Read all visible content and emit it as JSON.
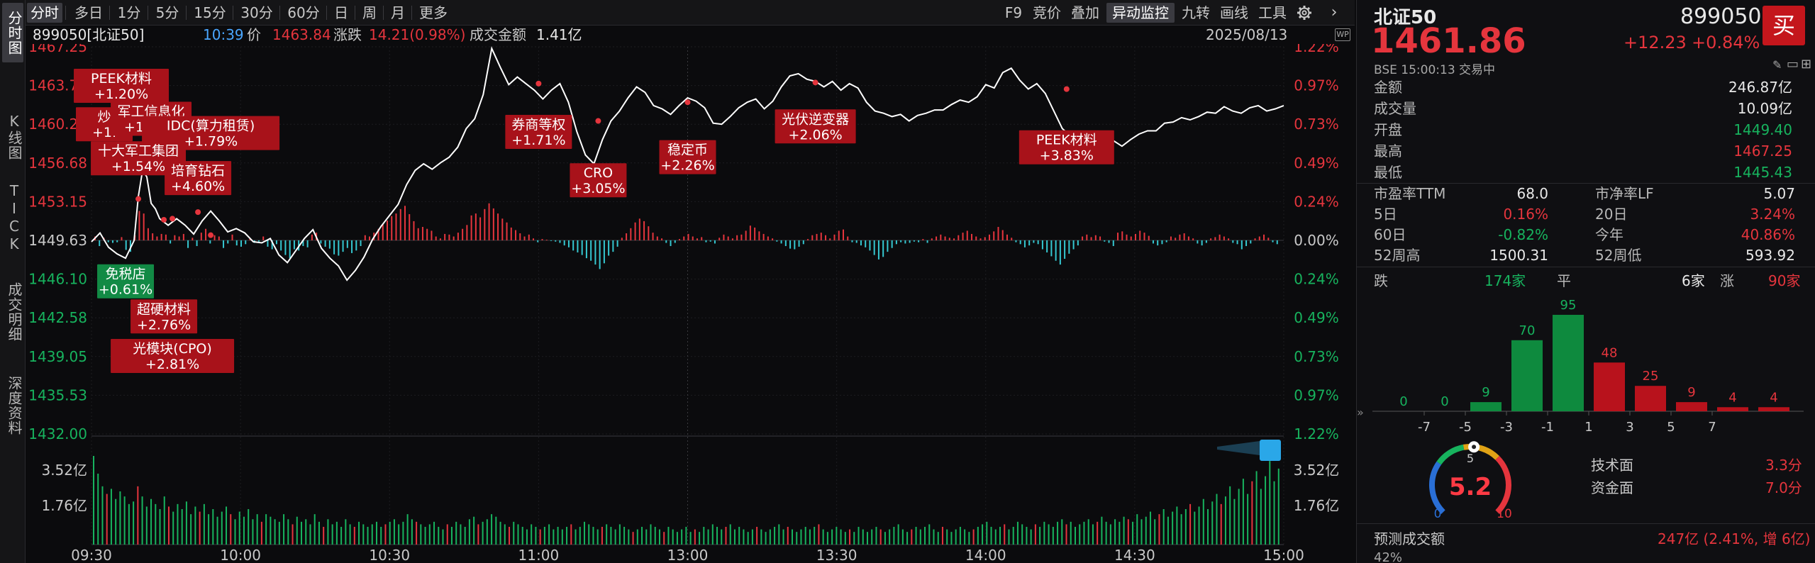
{
  "vtabs": [
    "分时图",
    "K线图",
    "TICK",
    "成交明细",
    "深度资料"
  ],
  "toolbar": {
    "periods": [
      "分时",
      "多日",
      "1分",
      "5分",
      "15分",
      "30分",
      "60分",
      "日",
      "周",
      "月",
      "更多"
    ],
    "tools": [
      "F9",
      "竞价",
      "叠加",
      "异动监控",
      "九转",
      "画线",
      "工具"
    ],
    "settings_icon": "gear-icon",
    "nav_icon": "chevron-right-icon"
  },
  "infoline": {
    "code": "899050[北证50]",
    "time": "10:39",
    "price_label": "价",
    "price": "1463.84",
    "change_label": "涨跌",
    "change": "14.21(0.98%)",
    "amount_label": "成交金额",
    "amount": "1.41亿",
    "date": "2025/08/13",
    "wp_icon": "wp-badge-icon"
  },
  "chart_data": {
    "type": "line",
    "x_ticks": [
      "09:30",
      "10:00",
      "10:30",
      "11:00",
      "13:00",
      "13:30",
      "14:00",
      "14:30",
      "15:00"
    ],
    "price_ticks": [
      "1467.25",
      "1463.72",
      "1460.20",
      "1456.68",
      "1453.15",
      "1449.63",
      "1446.10",
      "1442.58",
      "1439.05",
      "1435.53",
      "1432.00"
    ],
    "pct_ticks": [
      "1.22%",
      "0.97%",
      "0.73%",
      "0.49%",
      "0.24%",
      "0.00%",
      "0.24%",
      "0.49%",
      "0.73%",
      "0.97%",
      "1.22%"
    ],
    "pct_tick_colors": [
      "red",
      "red",
      "red",
      "red",
      "red",
      "grey",
      "green",
      "green",
      "green",
      "green",
      "green"
    ],
    "vol_ticks": [
      "3.52亿",
      "1.76亿"
    ],
    "ylim": [
      1432.0,
      1467.25
    ],
    "prev_close": 1449.63,
    "price_series": [
      [
        0,
        1449.5
      ],
      [
        2,
        1450.3
      ],
      [
        4,
        1449.0
      ],
      [
        6,
        1448.4
      ],
      [
        8,
        1448.0
      ],
      [
        10,
        1449.6
      ],
      [
        11,
        1453.6
      ],
      [
        12,
        1456.0
      ],
      [
        13,
        1455.4
      ],
      [
        14,
        1453.0
      ],
      [
        15,
        1452.5
      ],
      [
        16,
        1451.6
      ],
      [
        18,
        1451.0
      ],
      [
        20,
        1451.6
      ],
      [
        22,
        1451.0
      ],
      [
        24,
        1450.2
      ],
      [
        26,
        1451.4
      ],
      [
        28,
        1452.3
      ],
      [
        30,
        1451.4
      ],
      [
        32,
        1450.4
      ],
      [
        34,
        1450.7
      ],
      [
        36,
        1450.3
      ],
      [
        38,
        1449.5
      ],
      [
        40,
        1449.4
      ],
      [
        42,
        1449.8
      ],
      [
        44,
        1448.3
      ],
      [
        46,
        1447.6
      ],
      [
        48,
        1448.7
      ],
      [
        50,
        1449.8
      ],
      [
        52,
        1450.6
      ],
      [
        54,
        1448.9
      ],
      [
        56,
        1448.0
      ],
      [
        58,
        1447.3
      ],
      [
        60,
        1446.0
      ],
      [
        62,
        1446.9
      ],
      [
        64,
        1448.1
      ],
      [
        66,
        1449.7
      ],
      [
        68,
        1450.9
      ],
      [
        70,
        1451.9
      ],
      [
        72,
        1452.9
      ],
      [
        74,
        1454.7
      ],
      [
        76,
        1456.0
      ],
      [
        78,
        1456.6
      ],
      [
        80,
        1456.1
      ],
      [
        82,
        1456.7
      ],
      [
        84,
        1457.2
      ],
      [
        86,
        1458.1
      ],
      [
        88,
        1459.8
      ],
      [
        90,
        1460.7
      ],
      [
        92,
        1462.9
      ],
      [
        94,
        1467.1
      ],
      [
        96,
        1465.4
      ],
      [
        98,
        1463.8
      ],
      [
        100,
        1464.5
      ],
      [
        102,
        1463.9
      ],
      [
        104,
        1463.3
      ],
      [
        106,
        1462.5
      ],
      [
        108,
        1463.3
      ],
      [
        110,
        1463.9
      ],
      [
        112,
        1462.2
      ],
      [
        114,
        1459.5
      ],
      [
        116,
        1457.4
      ],
      [
        118,
        1456.6
      ],
      [
        120,
        1458.8
      ],
      [
        122,
        1460.5
      ],
      [
        124,
        1461.4
      ],
      [
        126,
        1462.6
      ],
      [
        128,
        1463.6
      ],
      [
        130,
        1463.1
      ],
      [
        132,
        1461.9
      ],
      [
        134,
        1461.6
      ],
      [
        136,
        1461.1
      ],
      [
        138,
        1461.9
      ],
      [
        140,
        1462.6
      ],
      [
        142,
        1462.3
      ],
      [
        144,
        1461.7
      ],
      [
        146,
        1460.3
      ],
      [
        148,
        1460.2
      ],
      [
        150,
        1460.9
      ],
      [
        152,
        1461.7
      ],
      [
        154,
        1462.2
      ],
      [
        156,
        1462.5
      ],
      [
        158,
        1461.6
      ],
      [
        160,
        1462.3
      ],
      [
        162,
        1463.6
      ],
      [
        164,
        1464.6
      ],
      [
        166,
        1464.8
      ],
      [
        168,
        1464.3
      ],
      [
        170,
        1464.1
      ],
      [
        172,
        1463.6
      ],
      [
        174,
        1464.1
      ],
      [
        176,
        1463.3
      ],
      [
        178,
        1463.9
      ],
      [
        180,
        1463.5
      ],
      [
        182,
        1462.2
      ],
      [
        184,
        1461.4
      ],
      [
        186,
        1461.2
      ],
      [
        188,
        1460.9
      ],
      [
        190,
        1461.1
      ],
      [
        192,
        1460.5
      ],
      [
        194,
        1461.0
      ],
      [
        196,
        1461.2
      ],
      [
        198,
        1461.5
      ],
      [
        200,
        1461.5
      ],
      [
        202,
        1462.0
      ],
      [
        204,
        1462.4
      ],
      [
        206,
        1462.2
      ],
      [
        208,
        1462.7
      ],
      [
        210,
        1463.8
      ],
      [
        212,
        1463.5
      ],
      [
        214,
        1464.9
      ],
      [
        216,
        1465.3
      ],
      [
        218,
        1464.2
      ],
      [
        220,
        1463.4
      ],
      [
        222,
        1463.9
      ],
      [
        224,
        1463.0
      ],
      [
        226,
        1461.4
      ],
      [
        228,
        1459.8
      ],
      [
        230,
        1459.1
      ],
      [
        232,
        1458.5
      ],
      [
        234,
        1456.8
      ],
      [
        236,
        1457.6
      ],
      [
        238,
        1457.2
      ],
      [
        240,
        1458.7
      ],
      [
        242,
        1458.2
      ],
      [
        244,
        1458.8
      ],
      [
        246,
        1459.3
      ],
      [
        248,
        1459.6
      ],
      [
        250,
        1459.6
      ],
      [
        252,
        1460.3
      ],
      [
        254,
        1460.4
      ],
      [
        256,
        1460.8
      ],
      [
        258,
        1460.6
      ],
      [
        260,
        1460.9
      ],
      [
        262,
        1461.3
      ],
      [
        264,
        1461.2
      ],
      [
        266,
        1461.8
      ],
      [
        268,
        1461.4
      ],
      [
        270,
        1461.2
      ],
      [
        272,
        1461.7
      ],
      [
        274,
        1461.9
      ],
      [
        276,
        1461.4
      ],
      [
        278,
        1461.6
      ],
      [
        280,
        1461.9
      ]
    ],
    "annotations": [
      {
        "label": "PEEK材料",
        "value": "+1.20%",
        "color": "red",
        "x": 7,
        "y": 1463.7
      },
      {
        "label": "炒",
        "value": "+1.",
        "color": "red",
        "x": 3,
        "y": 1460.2
      },
      {
        "label": "军工信息化",
        "value": "+1.65%",
        "color": "red",
        "x": 14,
        "y": 1460.7
      },
      {
        "label": "IDC(算力租赁)",
        "value": "+1.79%",
        "color": "red",
        "x": 28,
        "y": 1459.4
      },
      {
        "label": "十大军工集团",
        "value": "+1.54%",
        "color": "red",
        "x": 11,
        "y": 1457.1
      },
      {
        "label": "培育钻石",
        "value": "+4.60%",
        "color": "red",
        "x": 25,
        "y": 1455.3
      },
      {
        "label": "免税店",
        "value": "+0.61%",
        "color": "green",
        "x": 8,
        "y": 1445.9
      },
      {
        "label": "超硬材料",
        "value": "+2.76%",
        "color": "red",
        "x": 17,
        "y": 1442.7
      },
      {
        "label": "光模块(CPO)",
        "value": "+2.81%",
        "color": "red",
        "x": 19,
        "y": 1439.1
      },
      {
        "label": "券商等权",
        "value": "+1.71%",
        "color": "red",
        "x": 105,
        "y": 1459.5
      },
      {
        "label": "CRO",
        "value": "+3.05%",
        "color": "red",
        "x": 119,
        "y": 1455.1
      },
      {
        "label": "稳定币",
        "value": "+2.26%",
        "color": "red",
        "x": 140,
        "y": 1457.2
      },
      {
        "label": "光伏逆变器",
        "value": "+2.06%",
        "color": "red",
        "x": 170,
        "y": 1460.0
      },
      {
        "label": "PEEK材料",
        "value": "+3.83%",
        "color": "red",
        "x": 229,
        "y": 1458.1
      }
    ],
    "annotation_dots": [
      [
        11,
        1453.4
      ],
      [
        17,
        1451.5
      ],
      [
        19,
        1451.6
      ],
      [
        25,
        1452.2
      ],
      [
        28,
        1450.1
      ],
      [
        105,
        1463.9
      ],
      [
        119,
        1460.5
      ],
      [
        140,
        1462.2
      ],
      [
        170,
        1464.0
      ],
      [
        229,
        1463.4
      ]
    ],
    "diff_bars": [
      0.6,
      -0.9,
      0.4,
      -0.3,
      -0.4,
      -0.3,
      0.5,
      -1.5,
      -1.8,
      0.8,
      4.6,
      4.2,
      1.9,
      1.1,
      0.6,
      1.0,
      0.9,
      -0.5,
      0.8,
      0.6,
      1.0,
      -1.2,
      0.4,
      -0.9,
      1.2,
      1.8,
      -0.5,
      0.8,
      0.6,
      -1.2,
      -0.5,
      0.9,
      -0.8,
      -1.0,
      -0.6,
      0.3,
      -0.4,
      -0.2,
      0.6,
      -1.0,
      -1.4,
      -0.6,
      -1.6,
      -2.3,
      -2.8,
      -1.4,
      -1.6,
      -0.9,
      -1.1,
      0.9,
      1.2,
      -0.5,
      -1.0,
      -1.3,
      -2.2,
      -2.4,
      -1.8,
      -1.2,
      -2.0,
      -1.6,
      -0.9,
      0.8,
      0.6,
      1.2,
      1.8,
      2.6,
      3.1,
      3.8,
      4.2,
      4.9,
      5.4,
      4.1,
      3.0,
      1.9,
      2.1,
      1.8,
      1.5,
      0.6,
      0.3,
      1.0,
      0.9,
      0.6,
      1.2,
      1.8,
      2.4,
      3.9,
      4.2,
      3.6,
      4.9,
      5.8,
      5.0,
      4.2,
      3.4,
      2.8,
      2.0,
      1.6,
      1.1,
      0.6,
      0.9,
      0.3,
      -0.3,
      0.2,
      0.1,
      -0.1,
      -0.2,
      -0.4,
      -0.8,
      -1.1,
      -1.6,
      -1.9,
      -2.3,
      -2.8,
      -3.2,
      -3.8,
      -4.5,
      -3.6,
      -2.4,
      -1.8,
      -1.0,
      0.4,
      1.1,
      1.9,
      2.8,
      3.4,
      3.0,
      2.2,
      1.2,
      0.6,
      0.3,
      -0.4,
      -0.9,
      -0.4,
      0.2,
      0.6,
      1.0,
      0.6,
      0.3,
      0.5,
      -0.3,
      -0.2,
      -0.5,
      0.4,
      0.9,
      0.6,
      0.3,
      0.8,
      0.9,
      1.5,
      2.3,
      2.0,
      1.4,
      1.0,
      0.6,
      0.3,
      -0.2,
      -0.5,
      -0.9,
      -1.3,
      -1.4,
      -1.0,
      -0.6,
      0.2,
      0.8,
      1.0,
      1.2,
      0.8,
      0.3,
      0.9,
      1.5,
      1.7,
      0.6,
      -0.3,
      -0.4,
      -0.8,
      -1.1,
      -1.6,
      -2.3,
      -3.0,
      -2.6,
      -1.8,
      -1.2,
      -0.6,
      -0.3,
      -0.5,
      -0.4,
      -0.2,
      -0.3,
      0.2,
      -0.4,
      0.3,
      0.6,
      0.9,
      0.6,
      0.4,
      0.3,
      0.8,
      1.2,
      1.5,
      1.0,
      0.6,
      0.3,
      0.5,
      0.9,
      1.4,
      2.1,
      1.6,
      0.9,
      0.4,
      -0.3,
      -0.6,
      -1.1,
      -0.8,
      -0.4,
      -0.6,
      -1.4,
      -1.9,
      -2.5,
      -3.2,
      -3.8,
      -2.9,
      -2.1,
      -1.4,
      -0.8,
      0.6,
      0.9,
      0.5,
      0.8,
      0.6,
      -0.2,
      -0.4,
      -0.9,
      1.2,
      1.4,
      0.9,
      0.6,
      1.0,
      1.5,
      1.2,
      0.7,
      -0.5,
      -0.8,
      -0.6,
      -0.3,
      0.6,
      0.4,
      0.9,
      1.1,
      0.6,
      0.3,
      -0.5,
      -0.8,
      -0.4,
      0.3,
      0.5,
      0.9,
      0.6,
      0.3,
      -0.4,
      -0.6,
      -1.4,
      -0.9,
      -0.5,
      0.3,
      0.6,
      0.9,
      0.4,
      -0.3,
      -0.6
    ],
    "volume_bars": [
      3.5,
      2.8,
      2.3,
      2.0,
      2.2,
      1.8,
      2.1,
      1.9,
      1.6,
      1.7,
      2.3,
      1.9,
      1.5,
      1.8,
      1.6,
      1.4,
      1.9,
      1.5,
      1.3,
      1.6,
      1.4,
      1.7,
      1.2,
      1.5,
      1.3,
      1.6,
      1.2,
      1.4,
      1.1,
      1.3,
      1.5,
      1.2,
      1.0,
      1.3,
      1.1,
      1.4,
      1.0,
      1.2,
      0.9,
      1.2,
      1.1,
      1.0,
      0.9,
      1.2,
      1.0,
      0.8,
      1.1,
      0.9,
      1.0,
      0.8,
      1.2,
      0.9,
      0.7,
      1.0,
      0.8,
      0.9,
      0.7,
      1.0,
      0.8,
      0.7,
      0.9,
      0.8,
      0.7,
      0.8,
      0.9,
      0.7,
      0.8,
      0.9,
      1.0,
      0.8,
      0.9,
      1.2,
      1.0,
      0.9,
      0.8,
      0.7,
      0.8,
      0.9,
      0.7,
      0.6,
      0.8,
      0.7,
      0.9,
      0.8,
      0.7,
      1.0,
      1.1,
      0.8,
      0.9,
      1.0,
      1.2,
      1.1,
      0.9,
      0.8,
      0.7,
      0.9,
      0.8,
      0.7,
      0.6,
      0.8,
      0.7,
      0.6,
      0.7,
      0.8,
      0.6,
      0.7,
      0.6,
      0.7,
      0.8,
      0.6,
      0.7,
      0.9,
      0.8,
      0.7,
      0.6,
      0.7,
      0.8,
      0.7,
      0.6,
      0.8,
      0.7,
      0.6,
      0.5,
      0.6,
      0.7,
      0.6,
      0.8,
      0.7,
      0.6,
      0.5,
      0.7,
      0.6,
      0.5,
      0.6,
      0.7,
      0.5,
      0.6,
      0.5,
      0.7,
      0.6,
      0.8,
      0.7,
      0.6,
      0.7,
      0.8,
      0.6,
      0.7,
      0.6,
      0.5,
      0.6,
      0.7,
      0.6,
      0.5,
      0.6,
      0.7,
      0.8,
      0.6,
      0.7,
      0.6,
      0.5,
      0.6,
      0.7,
      0.6,
      0.7,
      0.8,
      0.6,
      0.5,
      0.6,
      0.7,
      0.6,
      0.5,
      0.6,
      0.5,
      0.7,
      0.6,
      0.5,
      0.6,
      0.7,
      0.6,
      0.5,
      0.6,
      0.7,
      0.8,
      0.6,
      0.5,
      0.6,
      0.7,
      0.6,
      0.7,
      0.8,
      0.6,
      0.5,
      0.7,
      0.6,
      0.5,
      0.6,
      0.7,
      0.6,
      0.5,
      0.6,
      0.7,
      0.8,
      0.9,
      0.7,
      0.6,
      0.7,
      0.8,
      0.6,
      0.7,
      0.9,
      0.8,
      0.7,
      0.6,
      0.8,
      0.7,
      0.9,
      0.8,
      0.7,
      0.9,
      1.0,
      0.8,
      0.9,
      0.7,
      0.8,
      0.9,
      1.0,
      0.8,
      0.9,
      1.1,
      0.9,
      0.8,
      1.0,
      0.9,
      1.1,
      1.0,
      0.9,
      1.2,
      1.0,
      1.1,
      1.3,
      1.0,
      1.2,
      1.4,
      1.1,
      1.3,
      1.5,
      1.2,
      1.4,
      1.6,
      1.3,
      1.5,
      1.8,
      1.4,
      1.7,
      2.0,
      1.6,
      1.9,
      2.3,
      1.8,
      2.2,
      2.6,
      2.0,
      2.5,
      2.9,
      2.2,
      2.7,
      3.3,
      2.5,
      3.0
    ],
    "vol_max": 4.2
  },
  "quote": {
    "name": "北证50",
    "code": "899050",
    "price": "1461.86",
    "change": "+12.23",
    "change_pct": "+0.84%",
    "exchange_line": "BSE  15:00:13  交易中",
    "buy_label": "买",
    "icons": [
      "pencil-icon",
      "minus-icon",
      "plus-icon"
    ]
  },
  "stats": [
    {
      "label": "金额",
      "value": "246.87亿",
      "color": "white"
    },
    {
      "label": "成交量",
      "value": "10.09亿",
      "color": "white"
    },
    {
      "label": "开盘",
      "value": "1449.40",
      "color": "green"
    },
    {
      "label": "最高",
      "value": "1467.25",
      "color": "red"
    },
    {
      "label": "最低",
      "value": "1445.43",
      "color": "green"
    }
  ],
  "stats2": [
    {
      "l1": "市盈率TTM",
      "v1": "68.0",
      "c1": "white",
      "l2": "市净率LF",
      "v2": "5.07",
      "c2": "white"
    },
    {
      "l1": "5日",
      "v1": "0.16%",
      "c1": "red",
      "l2": "20日",
      "v2": "3.24%",
      "c2": "red"
    },
    {
      "l1": "60日",
      "v1": "-0.82%",
      "c1": "green",
      "l2": "今年",
      "v2": "40.86%",
      "c2": "red"
    },
    {
      "l1": "52周高",
      "v1": "1500.31",
      "c1": "white",
      "l2": "52周低",
      "v2": "593.92",
      "c2": "white"
    }
  ],
  "breadth": {
    "down_label": "跌",
    "down": "174家",
    "flat_label": "平",
    "flat": "6家",
    "up_label": "涨",
    "up": "90家"
  },
  "dist_chart": {
    "type": "bar",
    "values": [
      0,
      0,
      9,
      70,
      95,
      48,
      25,
      9,
      4,
      4
    ],
    "colors": [
      "green",
      "green",
      "green",
      "green",
      "green",
      "red",
      "red",
      "red",
      "red",
      "red"
    ],
    "ticks": [
      "-7",
      "-5",
      "-3",
      "-1",
      "1",
      "3",
      "5",
      "7"
    ]
  },
  "gauge": {
    "score": "5.2",
    "min": "0",
    "mid": "5",
    "max": "10",
    "value": 5.2,
    "range": [
      0,
      10
    ]
  },
  "scores": [
    {
      "label": "技术面",
      "value": "3.3分"
    },
    {
      "label": "资金面",
      "value": "7.0分"
    }
  ],
  "forecast": {
    "label": "预测成交额",
    "value": "247亿 (2.41%, 增 6亿)",
    "extra": "42%"
  }
}
